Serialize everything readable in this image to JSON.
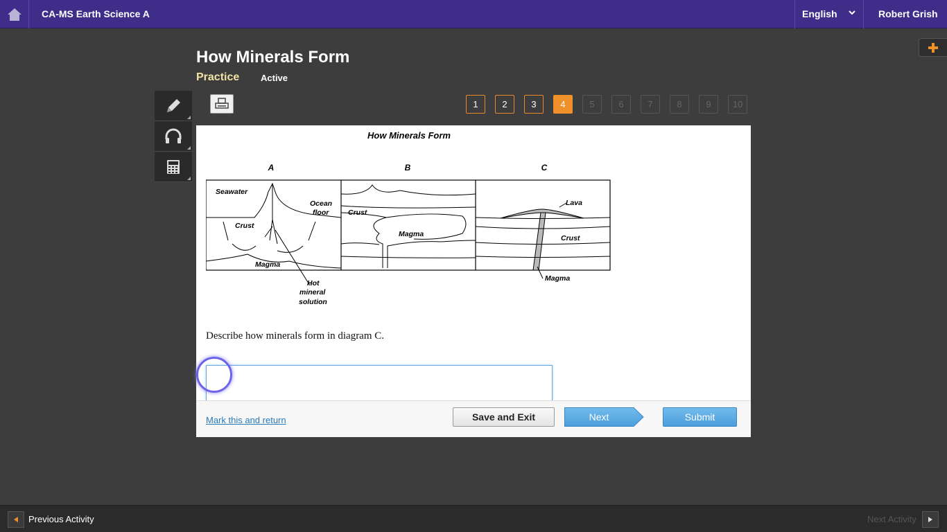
{
  "topbar": {
    "course_title": "CA-MS Earth Science A",
    "language": "English",
    "user_name": "Robert Grish"
  },
  "heading": {
    "title": "How Minerals Form",
    "mode": "Practice",
    "status": "Active"
  },
  "tools": [
    {
      "name": "pencil-icon"
    },
    {
      "name": "headphones-icon"
    },
    {
      "name": "calculator-icon"
    }
  ],
  "pager": {
    "pages": [
      "1",
      "2",
      "3",
      "4",
      "5",
      "6",
      "7",
      "8",
      "9",
      "10"
    ],
    "current": 4,
    "available": 4
  },
  "figure": {
    "title": "How Minerals Form",
    "panel_a": "A",
    "panel_b": "B",
    "panel_c": "C",
    "a_seawater": "Seawater",
    "a_ocean": "Ocean",
    "a_floor": "floor",
    "a_crust": "Crust",
    "a_magma": "Magma",
    "a_hot": "Hot",
    "a_mineral": "mineral",
    "a_solution": "solution",
    "b_crust": "Crust",
    "b_magma": "Magma",
    "c_lava": "Lava",
    "c_crust": "Crust",
    "c_magma": "Magma"
  },
  "question": {
    "prompt": "Describe how minerals form in diagram C.",
    "answer_value": ""
  },
  "footer": {
    "mark_link": "Mark this and return",
    "save_label": "Save and Exit",
    "next_label": "Next",
    "submit_label": "Submit"
  },
  "bottombar": {
    "prev_label": "Previous Activity",
    "next_label": "Next Activity"
  },
  "colors": {
    "topbar": "#3f2d8a",
    "accent_orange": "#f0902a",
    "button_blue": "#4b9edb"
  }
}
